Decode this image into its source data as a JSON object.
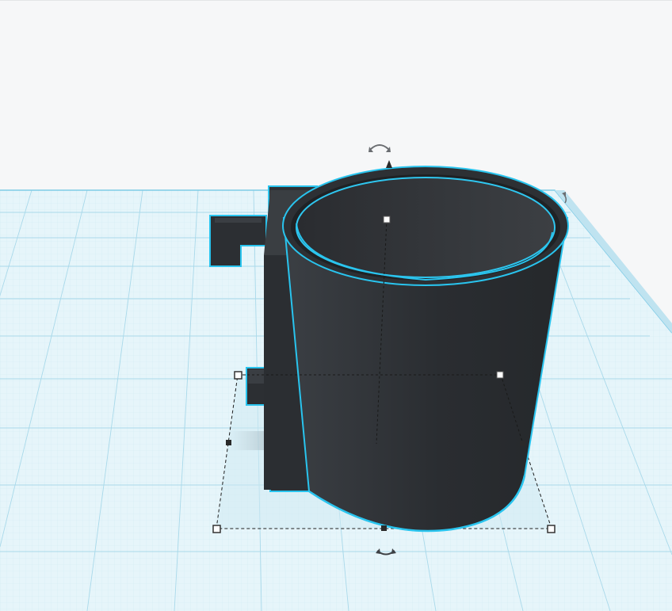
{
  "viewport": {
    "background_color": "#f6f7f8",
    "grid_color": "#cfeaf3",
    "grid_major_color": "#9ed3e6",
    "workplane_color": "#e4f4fa"
  },
  "object": {
    "shape": "mug",
    "body_color": "#2c2f33",
    "selection_outline_color": "#29c4ee"
  },
  "controls": {
    "rotate_top_icon": "rotate-arrow-icon",
    "rotate_bottom_icon": "rotate-arrow-icon",
    "height_handle_icon": "cone-arrow-icon",
    "corner_handle_icon": "square-handle-icon",
    "side_rotate_icon": "rotate-arrow-icon"
  }
}
